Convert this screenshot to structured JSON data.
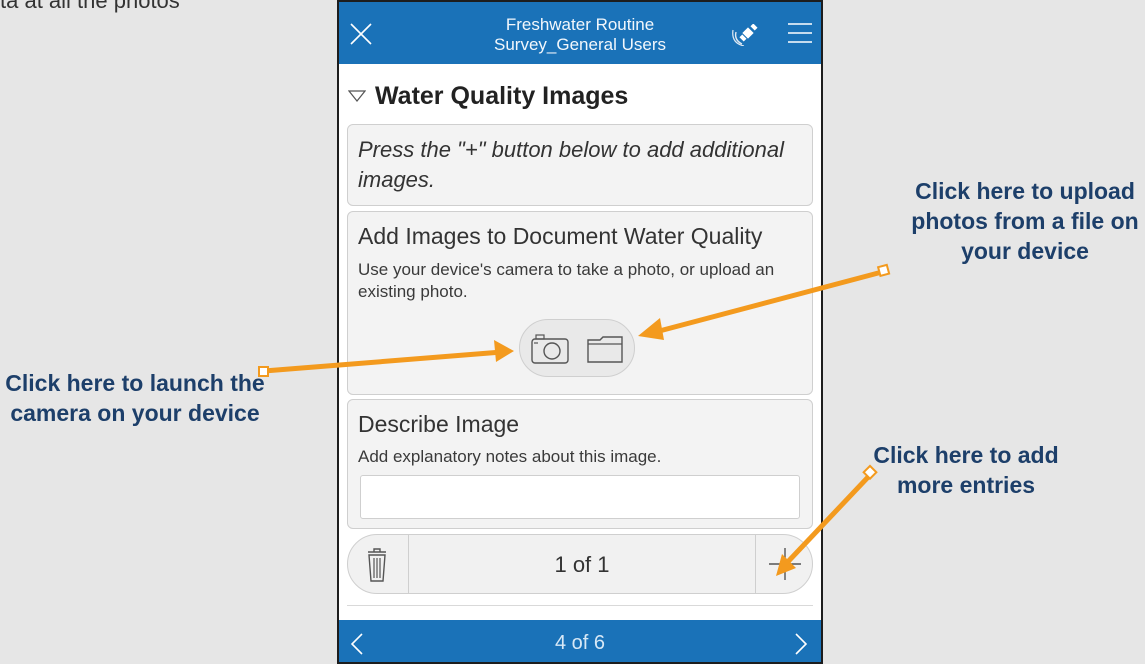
{
  "cut_off_text": "ta at all the photos",
  "app": {
    "title_line1": "Freshwater Routine",
    "title_line2": "Survey_General Users",
    "close_icon": "close-icon",
    "gps_icon": "satellite-icon",
    "menu_icon": "hamburger-menu-icon"
  },
  "group": {
    "title": "Water Quality Images",
    "collapse_icon": "triangle-down-icon"
  },
  "note_card": {
    "text": "Press the \"+\" button below to add additional images."
  },
  "image_question": {
    "label": "Add Images to Document Water Quality",
    "hint": "Use your device's camera to take a photo, or upload an existing photo.",
    "camera_icon": "camera-icon",
    "folder_icon": "folder-icon"
  },
  "describe_question": {
    "label": "Describe Image",
    "hint": "Add explanatory notes about this image.",
    "value": ""
  },
  "repeat_bar": {
    "counter": "1 of 1",
    "delete_icon": "trash-icon",
    "add_icon": "plus-icon"
  },
  "footer": {
    "page": "4 of 6",
    "prev_icon": "chevron-left-icon",
    "next_icon": "chevron-right-icon"
  },
  "annotations": {
    "upload_line1": "Click here to upload",
    "upload_line2": "photos from a file on",
    "upload_line3": "your device",
    "camera_line1": "Click here to launch the",
    "camera_line2": "camera on your device",
    "add_line1": "Click here to add",
    "add_line2": "more entries"
  },
  "colors": {
    "header_blue": "#1a72b8",
    "annotation_orange": "#f39a1e",
    "annotation_text": "#1d3f6a"
  }
}
